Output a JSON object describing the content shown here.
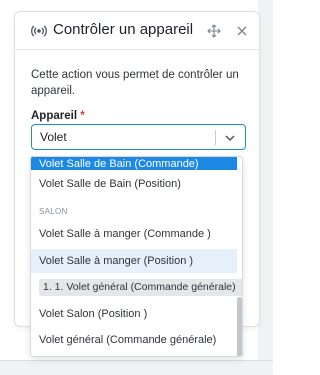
{
  "dialog": {
    "title": "Contrôler un appareil",
    "icon": "broadcast-icon",
    "description": "Cette action vous permet de contrôler un appareil."
  },
  "field": {
    "label": "Appareil",
    "required_mark": "*",
    "value": "Volet"
  },
  "menu": {
    "selected_option": "Volet Salle de Bain (Commande)",
    "option_1": "Volet Salle de Bain (Position)",
    "group_label": "SALON",
    "option_2": "Volet Salle à manger (Commande )",
    "option_hover": "Volet Salle à manger (Position )",
    "chip_label": "1. 1. Volet général (Commande générale)",
    "chip_remove": "×",
    "option_4": "Volet Salon (Position )",
    "option_5": "Volet général (Commande générale)"
  },
  "colors": {
    "accent": "#1e88e5",
    "hover": "#e6f0fb",
    "required": "#d33d3d"
  }
}
